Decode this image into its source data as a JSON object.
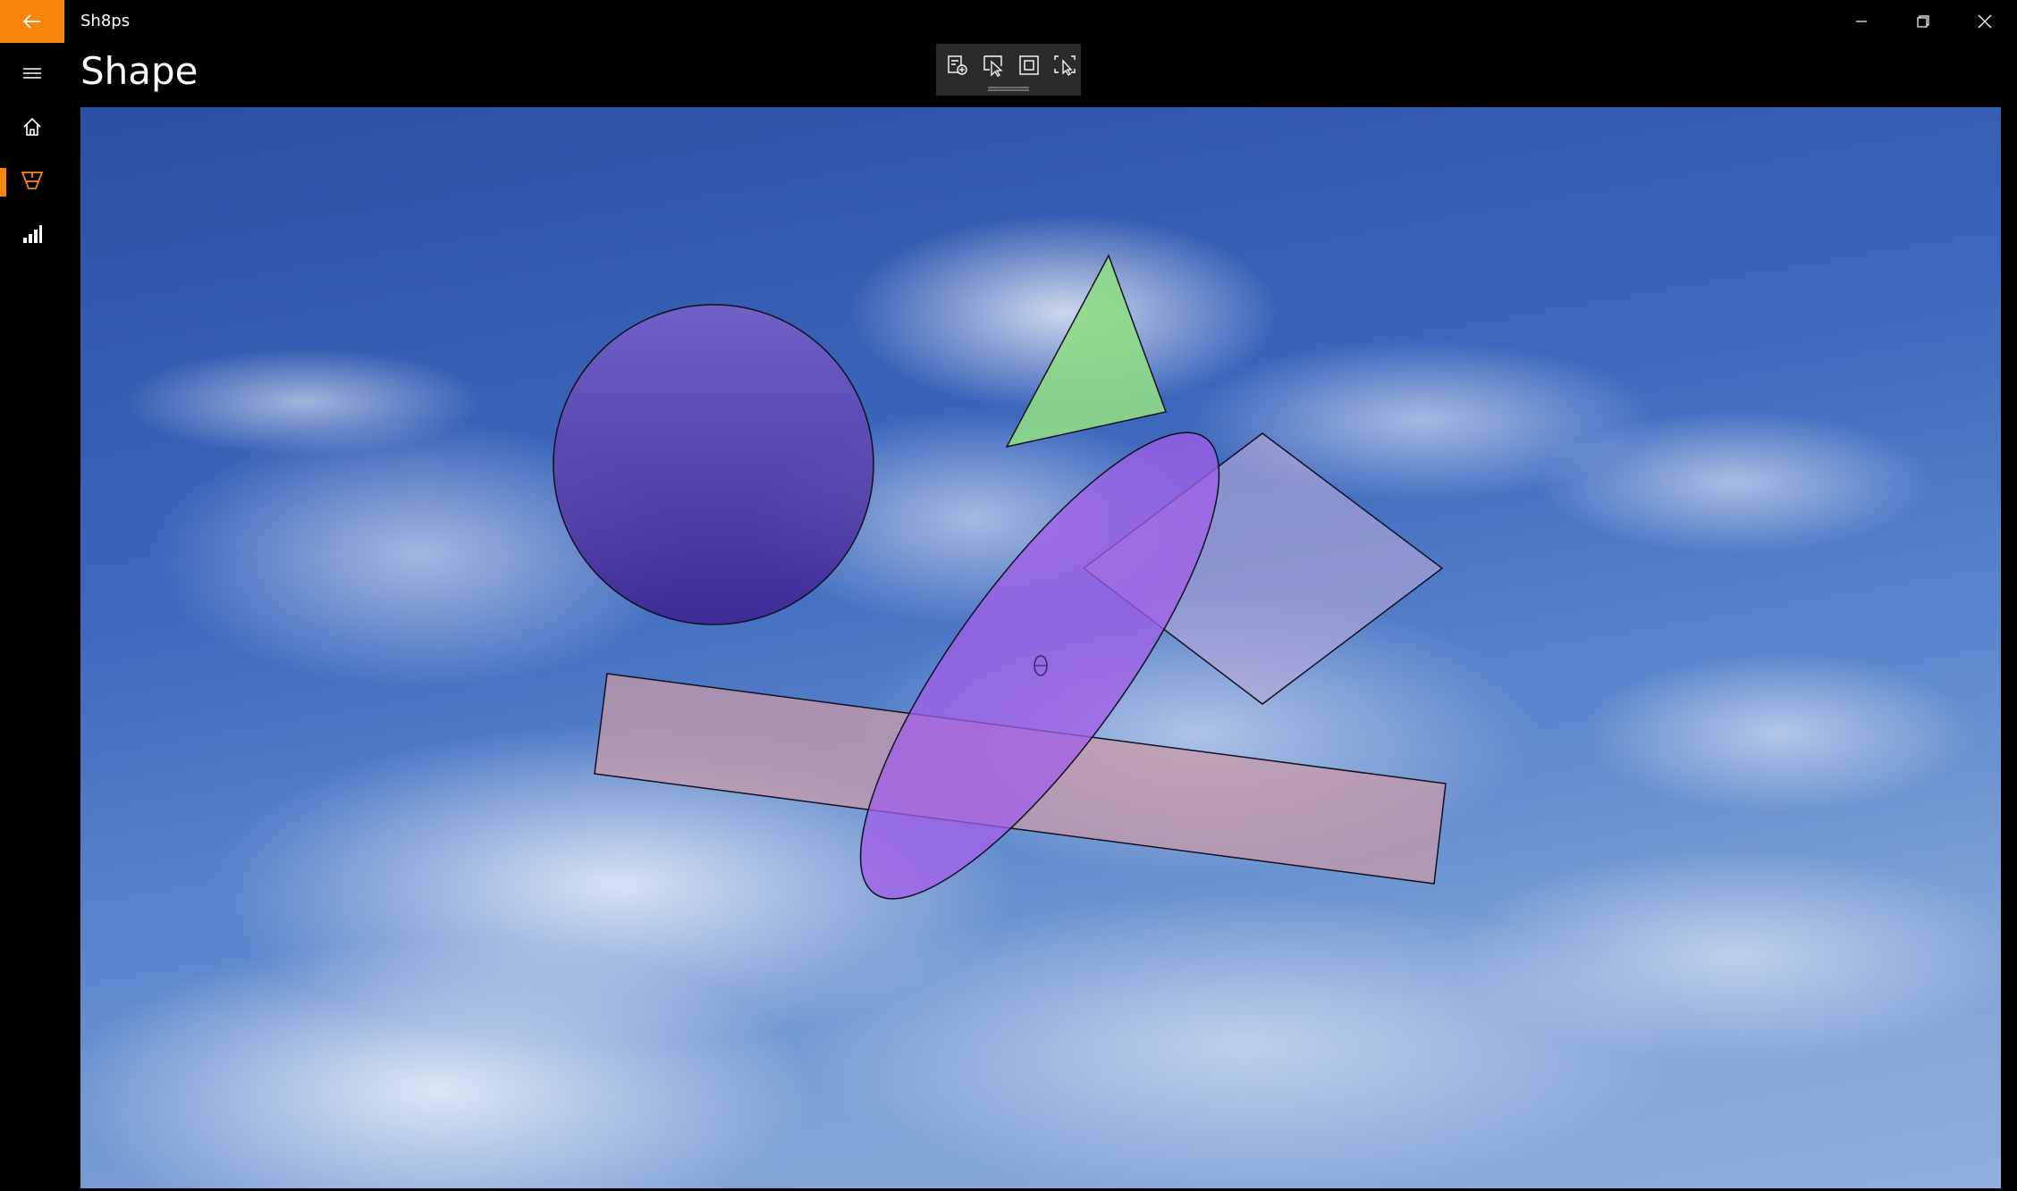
{
  "window": {
    "app_title": "Sh8ps",
    "minimize_icon": "minimize-icon",
    "restore_icon": "restore-icon",
    "close_icon": "close-icon"
  },
  "nav": {
    "back_icon": "back-arrow-icon",
    "menu_icon": "hamburger-icon",
    "items": [
      {
        "icon": "home-icon",
        "active": false
      },
      {
        "icon": "shapes-icon",
        "active": true
      },
      {
        "icon": "bar-chart-icon",
        "active": false
      }
    ]
  },
  "page": {
    "title": "Shape"
  },
  "toolbar": {
    "tools": [
      {
        "icon": "add-shape-icon"
      },
      {
        "icon": "select-icon"
      },
      {
        "icon": "square-frame-icon"
      },
      {
        "icon": "multi-select-icon"
      }
    ]
  },
  "canvas": {
    "background": "sky-with-clouds",
    "shapes": [
      {
        "kind": "circle",
        "fill": "#6a48c8",
        "opacity": 0.85
      },
      {
        "kind": "triangle",
        "fill": "#8fdc86",
        "opacity": 0.9
      },
      {
        "kind": "diamond",
        "fill": "#b9a8d8",
        "opacity": 0.6
      },
      {
        "kind": "rectangle",
        "fill": "#c89aa8",
        "opacity": 0.75
      },
      {
        "kind": "ellipse",
        "fill": "#a15ee8",
        "opacity": 0.75
      }
    ],
    "ellipse_center_marker": "ellipse-center-handle"
  },
  "colors": {
    "accent": "#f7860b",
    "chrome": "#000000",
    "toolbar_bg": "#2b2b2b"
  }
}
